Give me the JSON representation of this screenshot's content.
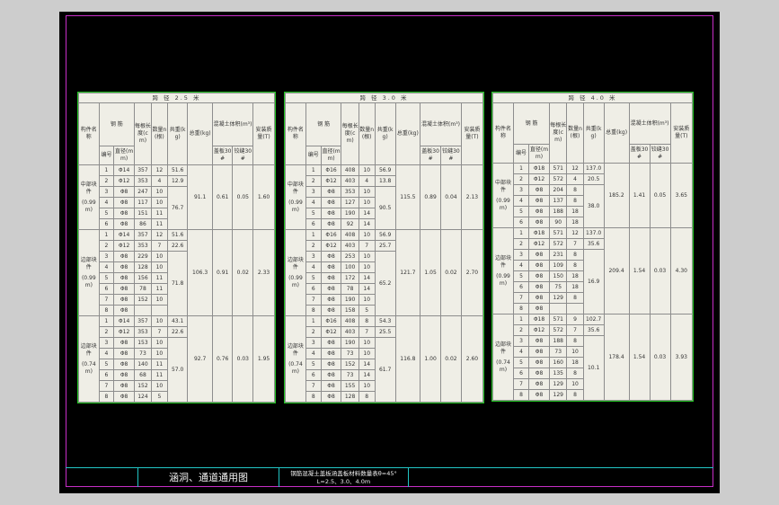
{
  "drawing": {
    "title": "涵洞、通道通用图",
    "subtitle_line1": "钢筋混凝土盖板涵盖板材料数量表θ=45°",
    "subtitle_line2": "L=2.5、3.0、4.0m"
  },
  "tables": [
    {
      "title": "跨 径 2.5 米",
      "head": {
        "name": "构件名称",
        "rebar": "钢 筋",
        "num": "编号",
        "dia": "直径(mm)",
        "len": "每根长度(cm)",
        "cnt": "数量n(根)",
        "weight": "共重(kg)",
        "total": "总重(kg)",
        "concrete": "混凝土体积(m³)",
        "c_a": "盖板30#",
        "c_b": "铰缝30#",
        "plate": "安装质量(T)"
      },
      "groups": [
        {
          "name": "中部块件",
          "size": "(0.99m)",
          "weight": "76.7",
          "total": "91.1",
          "c_a": "0.61",
          "c_b": "0.05",
          "plate": "1.60",
          "rows": [
            [
              "1",
              "Φ14",
              "357",
              "12",
              "51.6"
            ],
            [
              "2",
              "Φ12",
              "353",
              "4",
              "12.9"
            ],
            [
              "3",
              "Φ8",
              "247",
              "10",
              ""
            ],
            [
              "4",
              "Φ8",
              "117",
              "10",
              ""
            ],
            [
              "5",
              "Φ8",
              "151",
              "11",
              ""
            ],
            [
              "6",
              "Φ8",
              "86",
              "11",
              ""
            ]
          ]
        },
        {
          "name": "边部块件",
          "size": "(0.99m)",
          "weight": "71.8",
          "total": "106.3",
          "c_a": "0.91",
          "c_b": "0.02",
          "plate": "2.33",
          "rows": [
            [
              "1",
              "Φ14",
              "357",
              "12",
              "51.6"
            ],
            [
              "2",
              "Φ12",
              "353",
              "7",
              "22.6"
            ],
            [
              "3",
              "Φ8",
              "229",
              "10",
              ""
            ],
            [
              "4",
              "Φ8",
              "128",
              "10",
              ""
            ],
            [
              "5",
              "Φ8",
              "156",
              "11",
              ""
            ],
            [
              "6",
              "Φ8",
              "78",
              "11",
              ""
            ],
            [
              "7",
              "Φ8",
              "152",
              "10",
              ""
            ],
            [
              "8",
              "Φ8",
              "",
              "",
              ""
            ]
          ]
        },
        {
          "name": "边部块件",
          "size": "(0.74m)",
          "weight": "57.0",
          "total": "92.7",
          "c_a": "0.76",
          "c_b": "0.03",
          "plate": "1.95",
          "rows": [
            [
              "1",
              "Φ14",
              "357",
              "10",
              "43.1"
            ],
            [
              "2",
              "Φ12",
              "353",
              "7",
              "22.6"
            ],
            [
              "3",
              "Φ8",
              "153",
              "10",
              ""
            ],
            [
              "4",
              "Φ8",
              "73",
              "10",
              ""
            ],
            [
              "5",
              "Φ8",
              "140",
              "11",
              ""
            ],
            [
              "6",
              "Φ8",
              "68",
              "11",
              ""
            ],
            [
              "7",
              "Φ8",
              "152",
              "10",
              ""
            ],
            [
              "8",
              "Φ8",
              "124",
              "5",
              ""
            ]
          ]
        }
      ]
    },
    {
      "title": "跨 径 3.0 米",
      "head": {
        "name": "构件名称",
        "rebar": "钢 筋",
        "num": "编号",
        "dia": "直径(mm)",
        "len": "每根长度(cm)",
        "cnt": "数量n(根)",
        "weight": "共重(kg)",
        "total": "总重(kg)",
        "concrete": "混凝土体积(m³)",
        "c_a": "盖板30#",
        "c_b": "铰缝30#",
        "plate": "安装质量(T)"
      },
      "groups": [
        {
          "name": "中部块件",
          "size": "(0.99m)",
          "weight": "90.5",
          "total": "115.5",
          "c_a": "0.89",
          "c_b": "0.04",
          "plate": "2.13",
          "rows": [
            [
              "1",
              "Φ16",
              "408",
              "10",
              "56.9"
            ],
            [
              "2",
              "Φ12",
              "403",
              "4",
              "13.8"
            ],
            [
              "3",
              "Φ8",
              "353",
              "10",
              ""
            ],
            [
              "4",
              "Φ8",
              "127",
              "10",
              ""
            ],
            [
              "5",
              "Φ8",
              "190",
              "14",
              ""
            ],
            [
              "6",
              "Φ8",
              "92",
              "14",
              ""
            ]
          ]
        },
        {
          "name": "边部块件",
          "size": "(0.99m)",
          "weight": "65.2",
          "total": "121.7",
          "c_a": "1.05",
          "c_b": "0.02",
          "plate": "2.70",
          "rows": [
            [
              "1",
              "Φ16",
              "408",
              "10",
              "56.9"
            ],
            [
              "2",
              "Φ12",
              "403",
              "7",
              "25.7"
            ],
            [
              "3",
              "Φ8",
              "253",
              "10",
              ""
            ],
            [
              "4",
              "Φ8",
              "100",
              "10",
              ""
            ],
            [
              "5",
              "Φ8",
              "172",
              "14",
              ""
            ],
            [
              "6",
              "Φ8",
              "78",
              "14",
              ""
            ],
            [
              "7",
              "Φ8",
              "190",
              "10",
              ""
            ],
            [
              "8",
              "Φ8",
              "158",
              "5",
              ""
            ]
          ]
        },
        {
          "name": "边部块件",
          "size": "(0.74m)",
          "weight": "61.7",
          "total": "116.8",
          "c_a": "1.00",
          "c_b": "0.02",
          "plate": "2.60",
          "rows": [
            [
              "1",
              "Φ16",
              "408",
              "8",
              "54.3"
            ],
            [
              "2",
              "Φ12",
              "403",
              "7",
              "25.5"
            ],
            [
              "3",
              "Φ8",
              "190",
              "10",
              ""
            ],
            [
              "4",
              "Φ8",
              "73",
              "10",
              ""
            ],
            [
              "5",
              "Φ8",
              "152",
              "14",
              ""
            ],
            [
              "6",
              "Φ8",
              "73",
              "14",
              ""
            ],
            [
              "7",
              "Φ8",
              "155",
              "10",
              ""
            ],
            [
              "8",
              "Φ8",
              "128",
              "8",
              ""
            ]
          ]
        }
      ]
    },
    {
      "title": "跨 径 4.0 米",
      "head": {
        "name": "构件名称",
        "rebar": "钢 筋",
        "num": "编号",
        "dia": "直径(mm)",
        "len": "每根长度(cm)",
        "cnt": "数量n(根)",
        "weight": "共重(kg)",
        "total": "总重(kg)",
        "concrete": "混凝土体积(m³)",
        "c_a": "盖板30#",
        "c_b": "铰缝30#",
        "plate": "安装质量(T)"
      },
      "groups": [
        {
          "name": "中部块件",
          "size": "(0.99m)",
          "weight": "38.0",
          "total": "185.2",
          "c_a": "1.41",
          "c_b": "0.05",
          "plate": "3.65",
          "rows": [
            [
              "1",
              "Φ18",
              "571",
              "12",
              "137.0"
            ],
            [
              "2",
              "Φ12",
              "572",
              "4",
              "20.5"
            ],
            [
              "3",
              "Φ8",
              "204",
              "8",
              ""
            ],
            [
              "4",
              "Φ8",
              "137",
              "8",
              ""
            ],
            [
              "5",
              "Φ8",
              "188",
              "18",
              ""
            ],
            [
              "6",
              "Φ8",
              "90",
              "18",
              ""
            ]
          ]
        },
        {
          "name": "边部块件",
          "size": "(0.99m)",
          "weight": "16.9",
          "total": "209.4",
          "c_a": "1.54",
          "c_b": "0.03",
          "plate": "4.30",
          "rows": [
            [
              "1",
              "Φ18",
              "571",
              "12",
              "137.0"
            ],
            [
              "2",
              "Φ12",
              "572",
              "7",
              "35.6"
            ],
            [
              "3",
              "Φ8",
              "231",
              "8",
              ""
            ],
            [
              "4",
              "Φ8",
              "109",
              "8",
              ""
            ],
            [
              "5",
              "Φ8",
              "150",
              "18",
              ""
            ],
            [
              "6",
              "Φ8",
              "75",
              "18",
              ""
            ],
            [
              "7",
              "Φ8",
              "129",
              "8",
              ""
            ],
            [
              "8",
              "Φ8",
              "",
              "",
              ""
            ]
          ]
        },
        {
          "name": "边部块件",
          "size": "(0.74m)",
          "weight": "10.1",
          "total": "178.4",
          "c_a": "1.54",
          "c_b": "0.03",
          "plate": "3.93",
          "rows": [
            [
              "1",
              "Φ18",
              "571",
              "9",
              "102.7"
            ],
            [
              "2",
              "Φ12",
              "572",
              "7",
              "35.6"
            ],
            [
              "3",
              "Φ8",
              "188",
              "8",
              ""
            ],
            [
              "4",
              "Φ8",
              "73",
              "10",
              ""
            ],
            [
              "5",
              "Φ8",
              "160",
              "18",
              ""
            ],
            [
              "6",
              "Φ8",
              "135",
              "8",
              ""
            ],
            [
              "7",
              "Φ8",
              "129",
              "10",
              ""
            ],
            [
              "8",
              "Φ8",
              "129",
              "8",
              ""
            ]
          ]
        }
      ]
    }
  ]
}
